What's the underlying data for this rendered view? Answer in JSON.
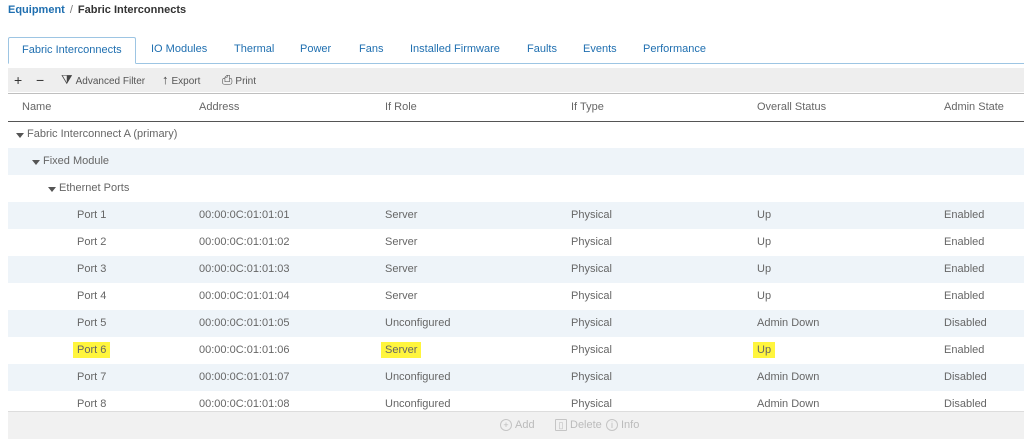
{
  "breadcrumb": {
    "root": "Equipment",
    "separator": "/",
    "current": "Fabric Interconnects"
  },
  "tabs": [
    {
      "label": "Fabric Interconnects",
      "active": true
    },
    {
      "label": "IO Modules"
    },
    {
      "label": "Thermal"
    },
    {
      "label": "Power"
    },
    {
      "label": "Fans"
    },
    {
      "label": "Installed Firmware"
    },
    {
      "label": "Faults"
    },
    {
      "label": "Events"
    },
    {
      "label": "Performance"
    }
  ],
  "toolbar": {
    "add_symbol": "+",
    "remove_symbol": "−",
    "filter_label": "Advanced Filter",
    "export_label": "Export",
    "print_label": "Print"
  },
  "columns": [
    "Name",
    "Address",
    "If Role",
    "If Type",
    "Overall Status",
    "Admin State"
  ],
  "tree": {
    "fabric": "Fabric Interconnect A (primary)",
    "module": "Fixed Module",
    "group": "Ethernet Ports"
  },
  "ports": [
    {
      "name": "Port 1",
      "address": "00:00:0C:01:01:01",
      "role": "Server",
      "type": "Physical",
      "status": "Up",
      "admin": "Enabled"
    },
    {
      "name": "Port 2",
      "address": "00:00:0C:01:01:02",
      "role": "Server",
      "type": "Physical",
      "status": "Up",
      "admin": "Enabled"
    },
    {
      "name": "Port 3",
      "address": "00:00:0C:01:01:03",
      "role": "Server",
      "type": "Physical",
      "status": "Up",
      "admin": "Enabled"
    },
    {
      "name": "Port 4",
      "address": "00:00:0C:01:01:04",
      "role": "Server",
      "type": "Physical",
      "status": "Up",
      "admin": "Enabled"
    },
    {
      "name": "Port 5",
      "address": "00:00:0C:01:01:05",
      "role": "Unconfigured",
      "type": "Physical",
      "status": "Admin Down",
      "admin": "Disabled"
    },
    {
      "name": "Port 6",
      "address": "00:00:0C:01:01:06",
      "role": "Server",
      "type": "Physical",
      "status": "Up",
      "admin": "Enabled",
      "highlighted": true
    },
    {
      "name": "Port 7",
      "address": "00:00:0C:01:01:07",
      "role": "Unconfigured",
      "type": "Physical",
      "status": "Admin Down",
      "admin": "Disabled"
    },
    {
      "name": "Port 8",
      "address": "00:00:0C:01:01:08",
      "role": "Unconfigured",
      "type": "Physical",
      "status": "Admin Down",
      "admin": "Disabled"
    }
  ],
  "footer": {
    "add_label": "Add",
    "delete_label": "Delete",
    "info_label": "Info"
  },
  "colors": {
    "link": "#1f6fb0",
    "row_shade": "#eef4f9",
    "highlight": "#fff53d",
    "toolbar_bg": "#eeeeee"
  }
}
